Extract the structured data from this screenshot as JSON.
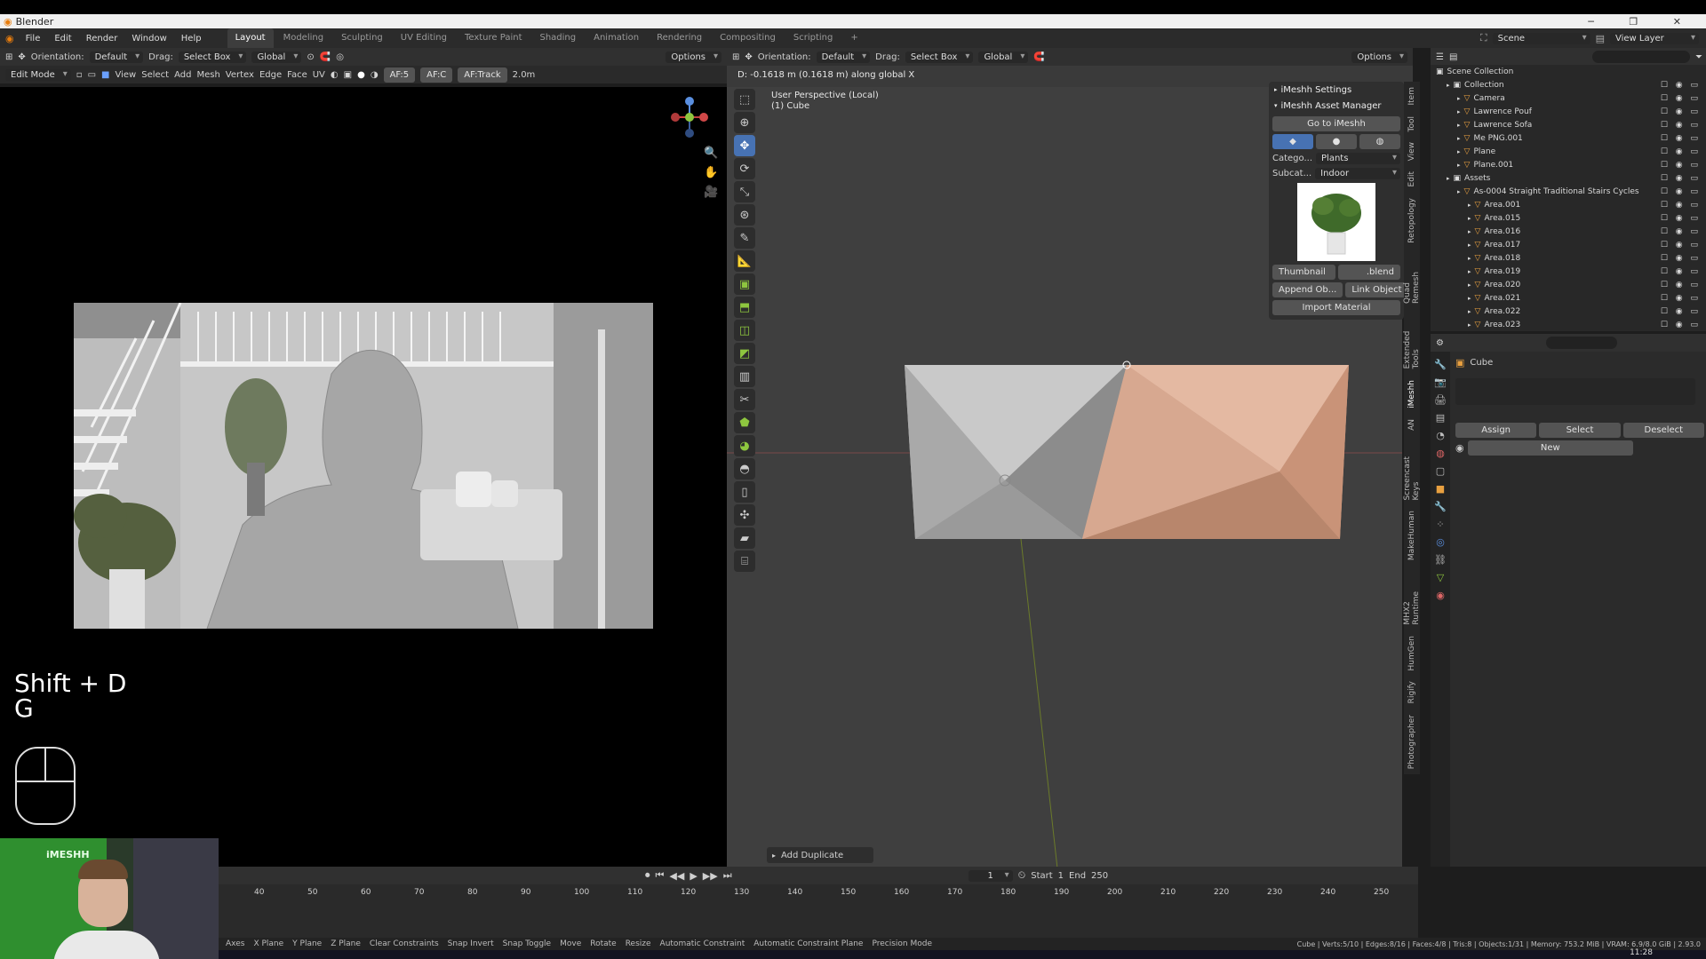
{
  "app": {
    "title": "Blender"
  },
  "menu": {
    "items": [
      "File",
      "Edit",
      "Render",
      "Window",
      "Help"
    ],
    "workspaces": [
      "Layout",
      "Modeling",
      "Sculpting",
      "UV Editing",
      "Texture Paint",
      "Shading",
      "Animation",
      "Rendering",
      "Compositing",
      "Scripting"
    ],
    "plus": "+"
  },
  "top_right": {
    "scene": "Scene",
    "view_layer": "View Layer"
  },
  "left_header": {
    "orientation_label": "Orientation:",
    "orientation_value": "Default",
    "drag_label": "Drag:",
    "drag_value": "Select Box",
    "transform": "Global",
    "options": "Options",
    "mode": "Edit Mode",
    "menus": [
      "View",
      "Select",
      "Add",
      "Mesh",
      "Vertex",
      "Edge",
      "Face",
      "UV"
    ],
    "af5": "AF:5",
    "afc": "AF:C",
    "aftrack": "AF:Track",
    "dist": "2.0m"
  },
  "right_header": {
    "orientation_label": "Orientation:",
    "orientation_value": "Default",
    "drag_label": "Drag:",
    "drag_value": "Select Box",
    "transform": "Global",
    "options": "Options"
  },
  "viewport": {
    "info": "D: -0.1618 m (0.1618 m) along global X",
    "perspective": "User Perspective (Local)",
    "object": "(1) Cube",
    "op_panel": "Add Duplicate"
  },
  "keys": {
    "line1": "Shift + D",
    "line2": "G"
  },
  "npanel": {
    "settings": "iMeshh Settings",
    "asset_manager": "iMeshh Asset Manager",
    "go_to": "Go to iMeshh",
    "category_label": "Catego...",
    "category_value": "Plants",
    "subcat_label": "Subcat...",
    "subcat_value": "Indoor",
    "thumbnail_btn": "Thumbnail",
    "blend_btn": ".blend",
    "append_btn": "Append Ob...",
    "link_btn": "Link Object",
    "import_btn": "Import Material"
  },
  "vertical_tabs": [
    "Item",
    "Tool",
    "View",
    "Edit",
    "Retopology",
    "Quad Remesh",
    "Extended Tools",
    "iMeshh",
    "AN",
    "Screencast Keys",
    "MakeHuman",
    "MHX2 Runtime",
    "HumGen",
    "Rigify",
    "Photographer"
  ],
  "outliner": {
    "scene_collection": "Scene Collection",
    "rows": [
      {
        "name": "Collection",
        "indent": 1
      },
      {
        "name": "Camera",
        "indent": 2
      },
      {
        "name": "Lawrence Pouf",
        "indent": 2
      },
      {
        "name": "Lawrence Sofa",
        "indent": 2
      },
      {
        "name": "Me PNG.001",
        "indent": 2
      },
      {
        "name": "Plane",
        "indent": 2
      },
      {
        "name": "Plane.001",
        "indent": 2
      },
      {
        "name": "Assets",
        "indent": 1
      },
      {
        "name": "As-0004 Straight Traditional Stairs Cycles",
        "indent": 2
      },
      {
        "name": "Area.001",
        "indent": 3
      },
      {
        "name": "Area.015",
        "indent": 3
      },
      {
        "name": "Area.016",
        "indent": 3
      },
      {
        "name": "Area.017",
        "indent": 3
      },
      {
        "name": "Area.018",
        "indent": 3
      },
      {
        "name": "Area.019",
        "indent": 3
      },
      {
        "name": "Area.020",
        "indent": 3
      },
      {
        "name": "Area.021",
        "indent": 3
      },
      {
        "name": "Area.022",
        "indent": 3
      },
      {
        "name": "Area.023",
        "indent": 3
      }
    ]
  },
  "properties": {
    "object": "Cube",
    "assign": "Assign",
    "select": "Select",
    "deselect": "Deselect",
    "new": "New"
  },
  "timeline": {
    "frame": "1",
    "start_label": "Start",
    "start": "1",
    "end_label": "End",
    "end": "250",
    "ticks": [
      "40",
      "50",
      "60",
      "70",
      "80",
      "90",
      "100",
      "110",
      "120",
      "130",
      "140",
      "150",
      "160",
      "170",
      "180",
      "190",
      "200",
      "210",
      "220",
      "230",
      "240",
      "250"
    ]
  },
  "status": {
    "items": [
      "X Plane",
      "Y Plane",
      "Z Plane",
      "Clear Constraints",
      "Snap Invert",
      "Snap Toggle",
      "Move",
      "Rotate",
      "Resize",
      "Automatic Constraint",
      "Automatic Constraint Plane",
      "Precision Mode"
    ],
    "prefix": "Axes",
    "stats": "Cube | Verts:5/10 | Edges:8/16 | Faces:4/8 | Tris:8 | Objects:1/31 | Memory: 753.2 MiB | VRAM: 6.9/8.0 GiB | 2.93.0"
  },
  "clock": "11:28",
  "webcam": {
    "logo": "iMESHH"
  },
  "colors": {
    "accent": "#4772b3",
    "active_orange": "#e8a040",
    "mesh_grey": "#b8b8b8",
    "mesh_skin": "#d9a98e"
  }
}
